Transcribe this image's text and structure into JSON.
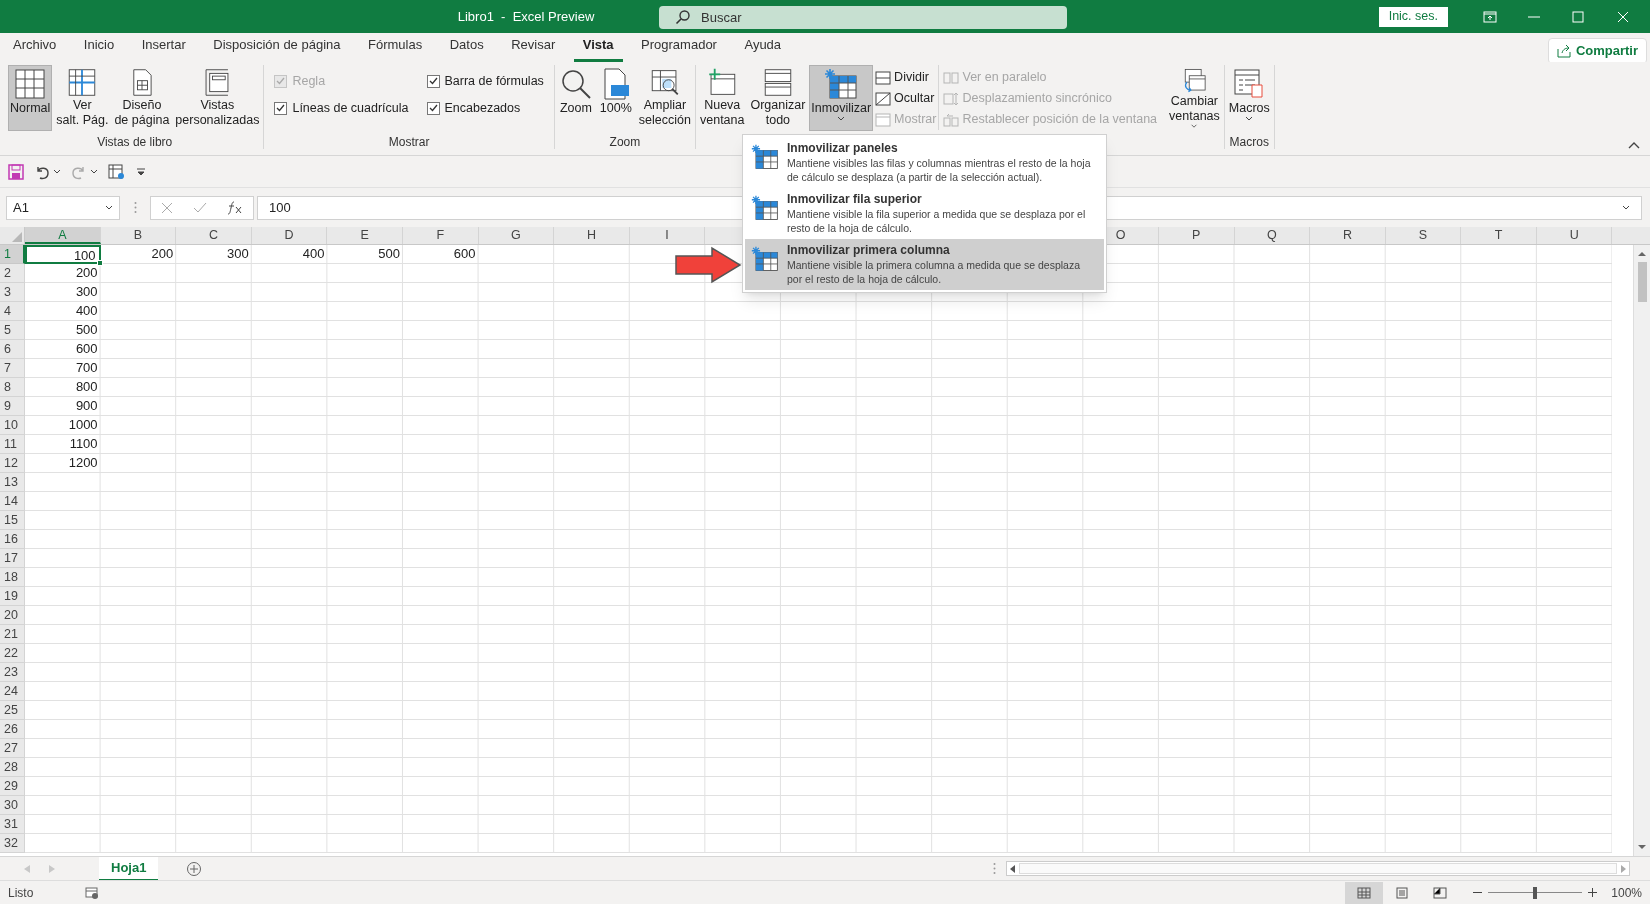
{
  "window": {
    "title": "Libro1  -  Excel Preview"
  },
  "search": {
    "placeholder": "Buscar"
  },
  "account_button": "Inic. ses.",
  "menu_tabs": [
    {
      "label": "Archivo",
      "selected": false
    },
    {
      "label": "Inicio",
      "selected": false
    },
    {
      "label": "Insertar",
      "selected": false
    },
    {
      "label": "Disposición de página",
      "selected": false
    },
    {
      "label": "Fórmulas",
      "selected": false
    },
    {
      "label": "Datos",
      "selected": false
    },
    {
      "label": "Revisar",
      "selected": false
    },
    {
      "label": "Vista",
      "selected": true
    },
    {
      "label": "Programador",
      "selected": false
    },
    {
      "label": "Ayuda",
      "selected": false
    }
  ],
  "share_button": "Compartir",
  "ribbon_groups": [
    {
      "label": "Vistas de libro",
      "items": [
        {
          "kind": "large",
          "label": "Normal",
          "selected": true,
          "dropdown": false
        },
        {
          "kind": "large",
          "label": "Ver salt. Pág.",
          "selected": false,
          "dropdown": false
        },
        {
          "kind": "large",
          "label": "Diseño de página",
          "selected": false,
          "dropdown": false
        },
        {
          "kind": "large",
          "label": "Vistas personalizadas",
          "selected": false,
          "dropdown": false
        }
      ]
    },
    {
      "label": "Mostrar",
      "items": [
        {
          "kind": "checks",
          "items": [
            {
              "label": "Regla",
              "checked": true,
              "disabled": true
            },
            {
              "label": "Líneas de cuadrícula",
              "checked": true,
              "disabled": false
            }
          ]
        },
        {
          "kind": "checks",
          "items": [
            {
              "label": "Barra de fórmulas",
              "checked": true,
              "disabled": false
            },
            {
              "label": "Encabezados",
              "checked": true,
              "disabled": false
            }
          ]
        }
      ]
    },
    {
      "label": "Zoom",
      "items": [
        {
          "kind": "large",
          "label": "Zoom",
          "selected": false,
          "dropdown": false
        },
        {
          "kind": "large",
          "label": "100%",
          "selected": false,
          "dropdown": false
        },
        {
          "kind": "large",
          "label": "Ampliar selección",
          "selected": false,
          "dropdown": false
        }
      ]
    },
    {
      "items": [
        {
          "kind": "large",
          "label": "Nueva ventana",
          "selected": false,
          "dropdown": false
        },
        {
          "kind": "large",
          "label": "Organizar todo",
          "selected": false,
          "dropdown": false
        },
        {
          "kind": "large",
          "label": "Inmovilizar",
          "selected": true,
          "dropdown": true
        },
        {
          "kind": "stack",
          "items": [
            {
              "label": "Dividir",
              "disabled": false
            },
            {
              "label": "Ocultar",
              "disabled": false
            },
            {
              "label": "Mostrar",
              "disabled": true
            }
          ]
        },
        {
          "kind": "stack",
          "items": [
            {
              "label": "Ver en paralelo",
              "disabled": true
            },
            {
              "label": "Desplazamiento sincrónico",
              "disabled": true
            },
            {
              "label": "Restablecer posición de la ventana",
              "disabled": true
            }
          ]
        },
        {
          "kind": "large",
          "label": "Cambiar ventanas",
          "selected": false,
          "dropdown": true
        }
      ]
    },
    {
      "label": "Macros",
      "items": [
        {
          "kind": "large",
          "label": "Macros",
          "selected": false,
          "dropdown": true
        }
      ]
    }
  ],
  "name_box": "A1",
  "formula": "100",
  "columns": [
    {
      "label": "A",
      "selected": true
    },
    {
      "label": "B",
      "selected": false
    },
    {
      "label": "C",
      "selected": false
    },
    {
      "label": "D",
      "selected": false
    },
    {
      "label": "E",
      "selected": false
    },
    {
      "label": "F",
      "selected": false
    },
    {
      "label": "G",
      "selected": false
    },
    {
      "label": "H",
      "selected": false
    },
    {
      "label": "I",
      "selected": false
    }
  ],
  "columns_after_menu": [
    {
      "label": "O",
      "selected": false
    },
    {
      "label": "P",
      "selected": false
    },
    {
      "label": "Q",
      "selected": false
    },
    {
      "label": "R",
      "selected": false
    },
    {
      "label": "S",
      "selected": false
    },
    {
      "label": "T",
      "selected": false
    },
    {
      "label": "U",
      "selected": false
    }
  ],
  "rows": [
    {
      "header": "1",
      "selected": true,
      "cells": [
        "100",
        "200",
        "300",
        "400",
        "500",
        "600"
      ]
    },
    {
      "header": "2",
      "selected": false,
      "cells": [
        "200"
      ]
    },
    {
      "header": "3",
      "selected": false,
      "cells": [
        "300"
      ]
    },
    {
      "header": "4",
      "selected": false,
      "cells": [
        "400"
      ]
    },
    {
      "header": "5",
      "selected": false,
      "cells": [
        "500"
      ]
    },
    {
      "header": "6",
      "selected": false,
      "cells": [
        "600"
      ]
    },
    {
      "header": "7",
      "selected": false,
      "cells": [
        "700"
      ]
    },
    {
      "header": "8",
      "selected": false,
      "cells": [
        "800"
      ]
    },
    {
      "header": "9",
      "selected": false,
      "cells": [
        "900"
      ]
    },
    {
      "header": "10",
      "selected": false,
      "cells": [
        "1000"
      ]
    },
    {
      "header": "11",
      "selected": false,
      "cells": [
        "1100"
      ]
    },
    {
      "header": "12",
      "selected": false,
      "cells": [
        "1200"
      ]
    },
    {
      "header": "13",
      "selected": false
    },
    {
      "header": "14",
      "selected": false
    },
    {
      "header": "15",
      "selected": false
    },
    {
      "header": "16",
      "selected": false
    },
    {
      "header": "17",
      "selected": false
    },
    {
      "header": "18",
      "selected": false
    },
    {
      "header": "19",
      "selected": false
    },
    {
      "header": "20",
      "selected": false
    },
    {
      "header": "21",
      "selected": false
    },
    {
      "header": "22",
      "selected": false
    },
    {
      "header": "23",
      "selected": false
    },
    {
      "header": "24",
      "selected": false
    },
    {
      "header": "25",
      "selected": false
    },
    {
      "header": "26",
      "selected": false
    },
    {
      "header": "27",
      "selected": false
    },
    {
      "header": "28",
      "selected": false
    },
    {
      "header": "29",
      "selected": false
    },
    {
      "header": "30",
      "selected": false
    },
    {
      "header": "31",
      "selected": false
    },
    {
      "header": "32",
      "selected": false
    }
  ],
  "freeze_menu": [
    {
      "title": "Inmovilizar paneles",
      "description": "Mantiene visibles las filas y columnas mientras el resto de la hoja de cálculo se desplaza (a partir de la selección actual).",
      "selected": false
    },
    {
      "title": "Inmovilizar fila superior",
      "description": "Mantiene visible la fila superior a medida que se desplaza por el resto de la hoja de cálculo.",
      "selected": false
    },
    {
      "title": "Inmovilizar primera columna",
      "description": "Mantiene visible la primera columna a medida que se desplaza por el resto de la hoja de cálculo.",
      "selected": true
    }
  ],
  "sheet_tabs": [
    {
      "label": "Hoja1",
      "selected": true
    }
  ],
  "status_bar": {
    "status": "Listo",
    "views": [
      {
        "selected": true
      },
      {
        "selected": false
      },
      {
        "selected": false
      }
    ],
    "zoom": {
      "level": 0.5,
      "reading": "100%"
    }
  }
}
